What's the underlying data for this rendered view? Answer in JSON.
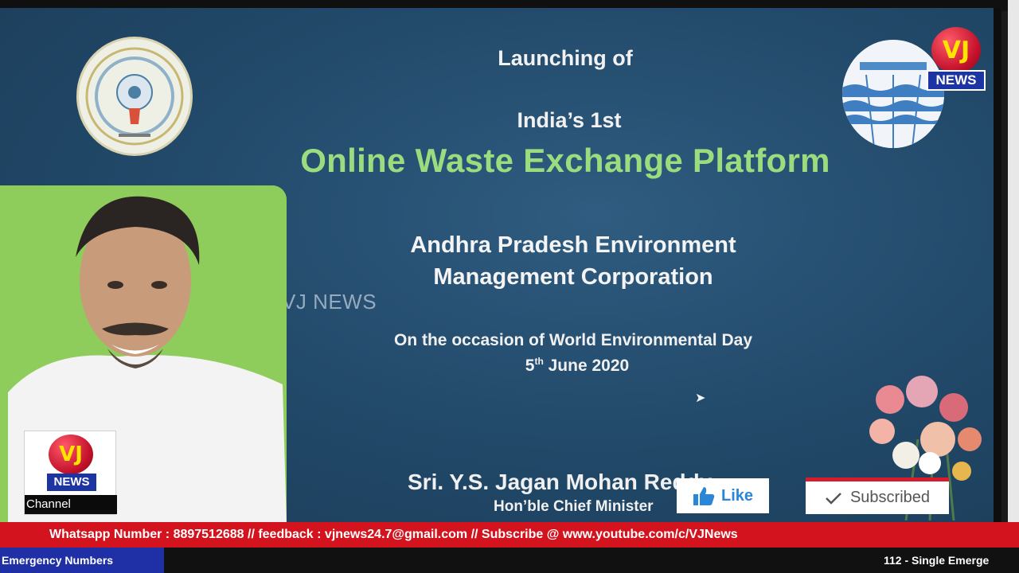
{
  "slide": {
    "launching": "Launching of",
    "first": "India’s 1st",
    "platform": "Online Waste Exchange Platform",
    "org_line1": "Andhra Pradesh Environment",
    "org_line2": "Management Corporation",
    "occasion": "On the occasion of World Environmental Day",
    "date_day": "5",
    "date_suffix": "th",
    "date_rest": " June 2020",
    "person_name": "Sri. Y.S. Jagan Mohan Reddy",
    "person_title": "Hon’ble Chief Minister"
  },
  "watermark": "VJ NEWS",
  "logo": {
    "letters": "VJ",
    "news": "NEWS"
  },
  "channel_box": {
    "letters": "VJ",
    "news": "NEWS",
    "label": "Channel"
  },
  "buttons": {
    "like": "Like",
    "subscribed": "Subscribed"
  },
  "ticker": "Whatsapp Number : 8897512688 // feedback : vjnews24.7@gmail.com // Subscribe @ www.youtube.com/c/VJNews",
  "emergency": {
    "label": "Emergency Numbers",
    "text": "112 - Single Emerge"
  },
  "colors": {
    "ticker": "#d3141e",
    "platform_text": "#9bdc7e",
    "brand_blue": "#1d35a3"
  }
}
